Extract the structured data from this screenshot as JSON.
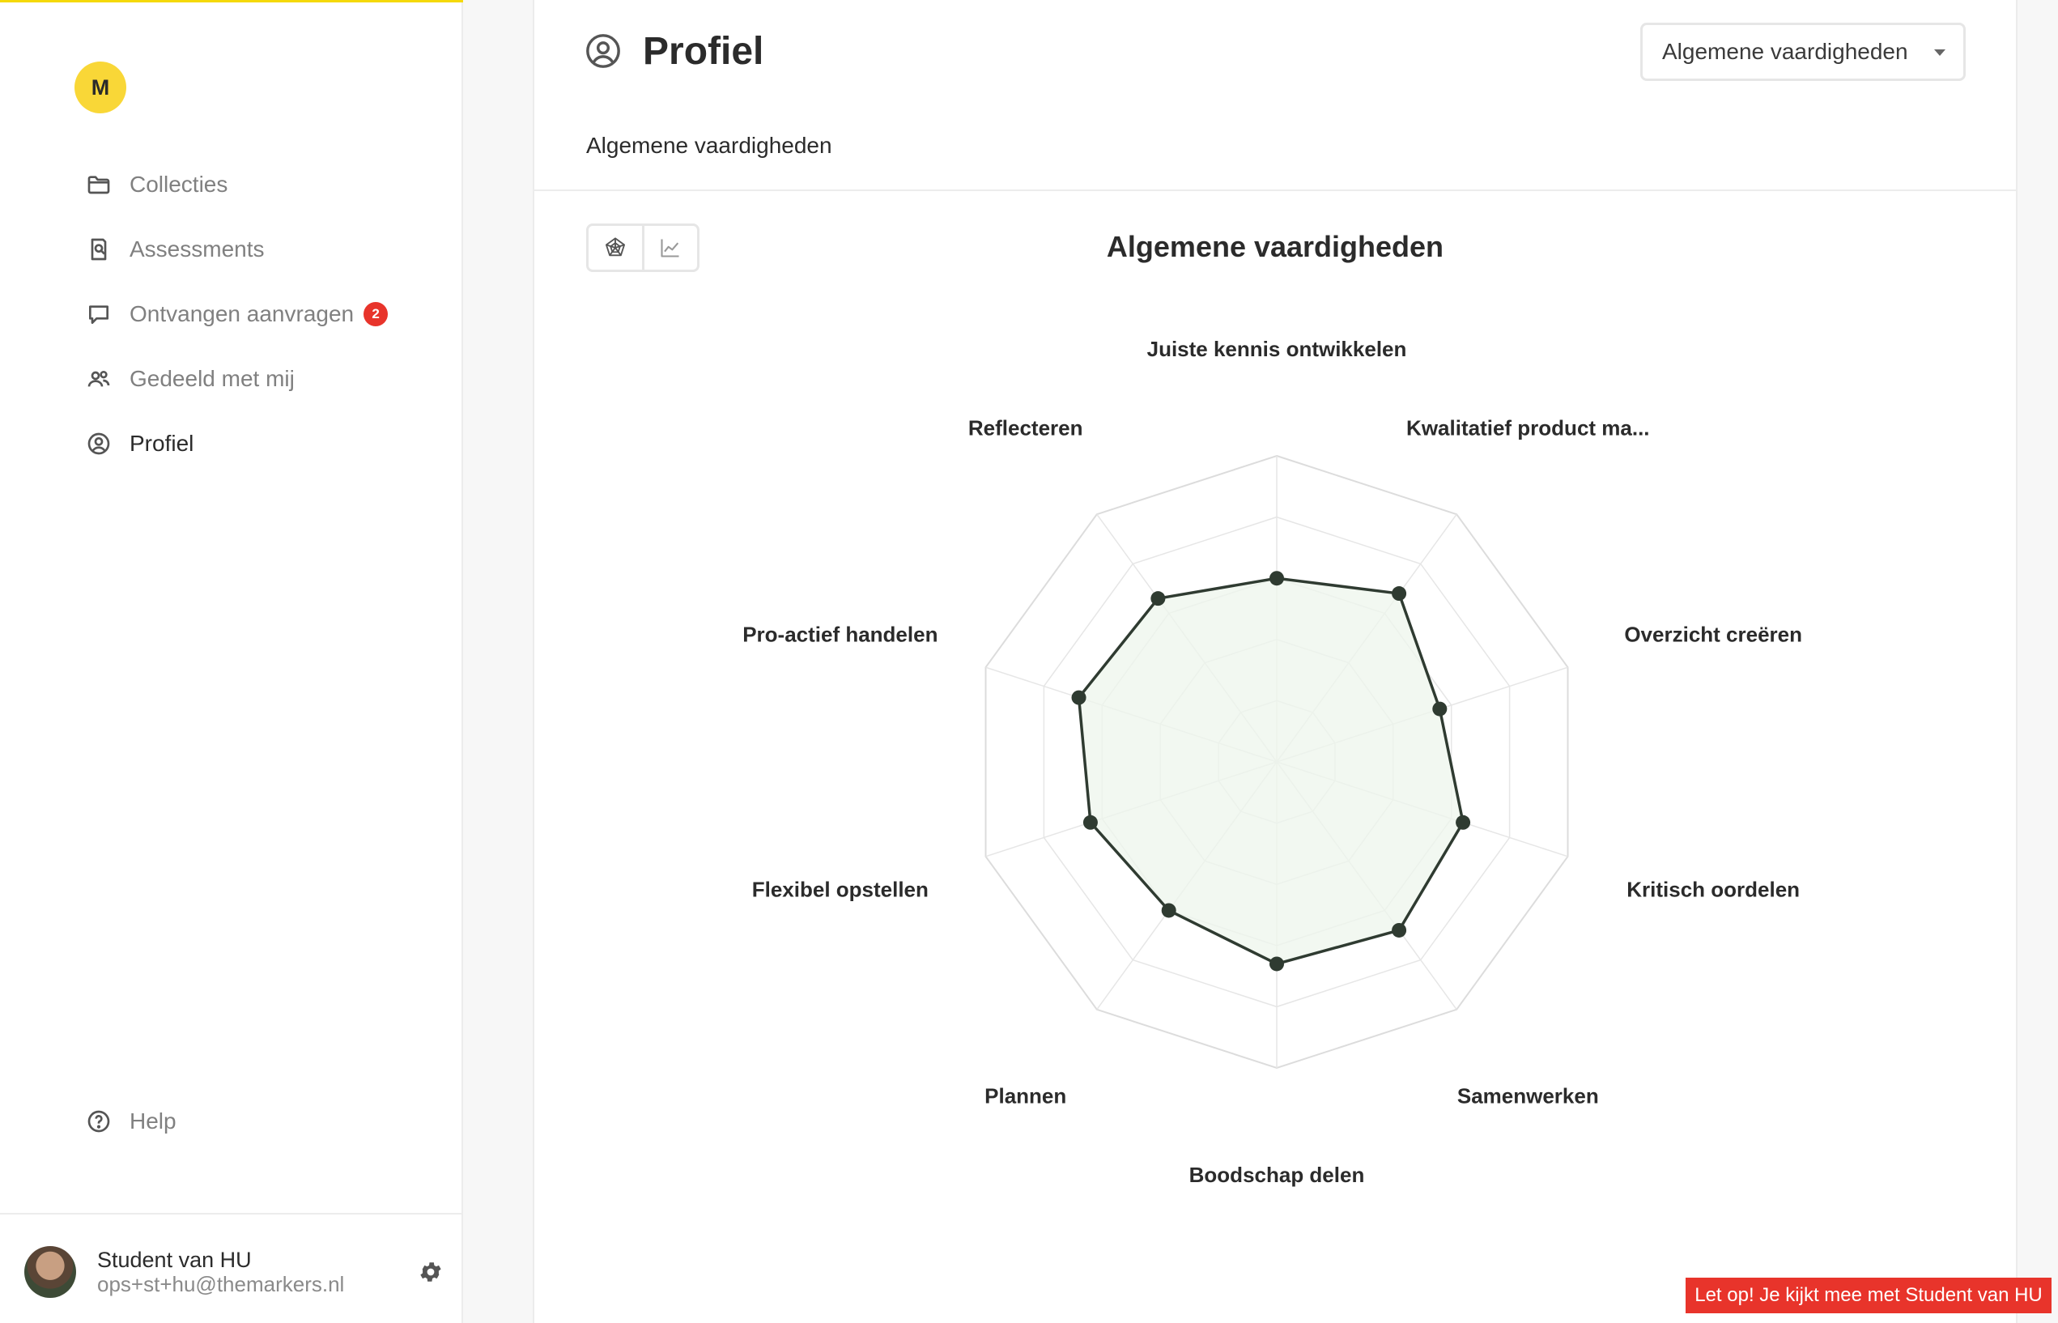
{
  "app": {
    "logo_letter": "M",
    "accent_color": "#f9d737",
    "badge_color": "#e8342b"
  },
  "sidebar": {
    "items": [
      {
        "label": "Collecties",
        "icon": "folder-icon"
      },
      {
        "label": "Assessments",
        "icon": "assessment-icon"
      },
      {
        "label": "Ontvangen aanvragen",
        "icon": "chat-icon",
        "badge": "2"
      },
      {
        "label": "Gedeeld met mij",
        "icon": "users-icon"
      },
      {
        "label": "Profiel",
        "icon": "user-circle-icon",
        "active": true
      }
    ],
    "help_label": "Help"
  },
  "user": {
    "name": "Student van HU",
    "email": "ops+st+hu@themarkers.nl"
  },
  "header": {
    "title": "Profiel",
    "dropdown_value": "Algemene vaardigheden",
    "subtitle": "Algemene vaardigheden"
  },
  "chart_data": {
    "type": "radar",
    "title": "Algemene vaardigheden",
    "categories": [
      "Juiste kennis ontwikkelen",
      "Kwalitatief product ma...",
      "Overzicht creëren",
      "Kritisch oordelen",
      "Samenwerken",
      "Boodschap delen",
      "Plannen",
      "Flexibel opstellen",
      "Pro-actief handelen",
      "Reflecteren"
    ],
    "values": [
      3.0,
      3.4,
      2.8,
      3.2,
      3.4,
      3.3,
      3.0,
      3.2,
      3.4,
      3.3
    ],
    "rmax": 5,
    "rings": 5,
    "grid": true,
    "line_color": "#2f3b31",
    "fill_color": "#eef6ec"
  },
  "banner": {
    "text": "Let op! Je kijkt mee met Student van HU"
  }
}
